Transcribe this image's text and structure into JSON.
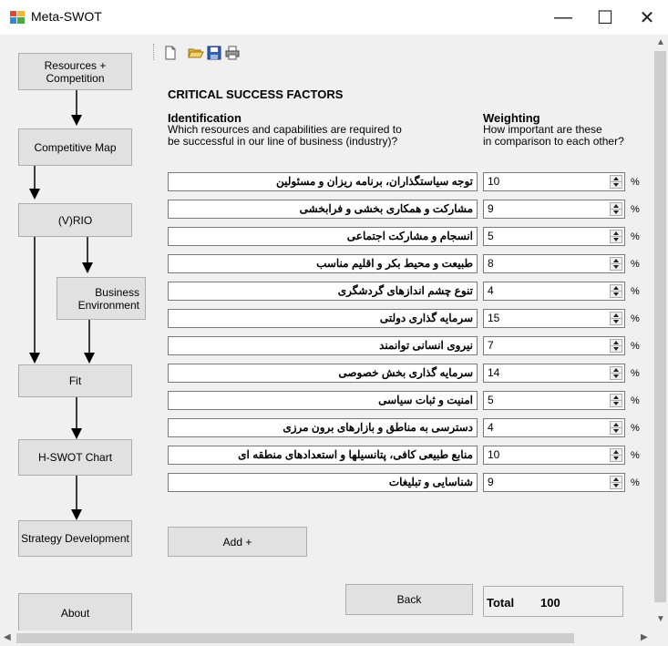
{
  "window": {
    "title": "Meta-SWOT",
    "minimize": "—",
    "maximize": "☐",
    "close": "✕"
  },
  "nav": {
    "resources": "Resources + Competition",
    "competitive_map": "Competitive Map",
    "vrio": "(V)RIO",
    "business_env": "Business Environment",
    "fit": "Fit",
    "hswot": "H-SWOT Chart",
    "strategy": "Strategy Development",
    "about": "About"
  },
  "toolbar": {
    "icons": [
      "new-file-icon",
      "open-folder-icon",
      "save-icon",
      "print-icon"
    ]
  },
  "main": {
    "section_title": "CRITICAL SUCCESS FACTORS",
    "identification": {
      "title": "Identification",
      "line1": "Which resources and capabilities are required to",
      "line2": "be successful in our line of business (industry)?"
    },
    "weighting": {
      "title": "Weighting",
      "line1": "How important are these",
      "line2": "in comparison to each other?"
    },
    "pct_symbol": "%",
    "rows": [
      {
        "factor": "توجه سیاستگذاران، برنامه ریزان و مسئولین",
        "weight": "10"
      },
      {
        "factor": "مشارکت و همکاری بخشی و فرابخشی",
        "weight": "9"
      },
      {
        "factor": "انسجام و مشارکت اجتماعی",
        "weight": "5"
      },
      {
        "factor": "طبیعت و محیط بکر و اقلیم مناسب",
        "weight": "8"
      },
      {
        "factor": "تنوع چشم اندازهای گردشگری",
        "weight": "4"
      },
      {
        "factor": "سرمایه گذاری دولتی",
        "weight": "15"
      },
      {
        "factor": "نیروی انسانی توانمند",
        "weight": "7"
      },
      {
        "factor": "سرمایه گذاری بخش خصوصی",
        "weight": "14"
      },
      {
        "factor": "امنیت و ثبات سیاسی",
        "weight": "5"
      },
      {
        "factor": "دسترسی به مناطق و بازارهای برون مرزی",
        "weight": "4"
      },
      {
        "factor": "منابع طبیعی کافی، پتانسیلها و استعدادهای منطقه ای",
        "weight": "10"
      },
      {
        "factor": "شناسایی و تبلیغات",
        "weight": "9"
      }
    ],
    "add_label": "Add +",
    "back_label": "Back",
    "total_label": "Total",
    "total_value": "100"
  },
  "colors": {
    "button_bg": "#e1e1e1",
    "button_border": "#adadad",
    "window_bg": "#f0f0f0"
  }
}
